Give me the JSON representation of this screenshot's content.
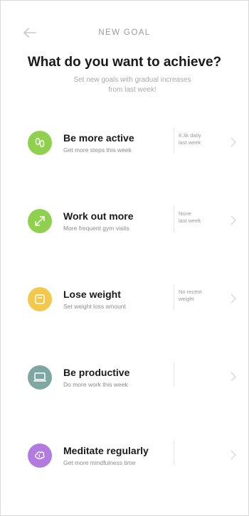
{
  "header": {
    "title": "NEW GOAL",
    "back_icon": "arrow-left-icon"
  },
  "headline": "What do you want to achieve?",
  "subtitle": "Set new goals with gradual increases from last week!",
  "goals": [
    {
      "title": "Be more active",
      "subtitle": "Get more steps this week",
      "stat": "8.3k daily\nlast week",
      "icon": "footprints-icon",
      "color": "#8fd14f"
    },
    {
      "title": "Work out more",
      "subtitle": "More frequent gym visits",
      "stat": "None\nlast week",
      "icon": "expand-arrows-icon",
      "color": "#8fd14f"
    },
    {
      "title": "Lose weight",
      "subtitle": "Set weight loss amount",
      "stat": "No recent\nweight",
      "icon": "scale-icon",
      "color": "#f2c94c"
    },
    {
      "title": "Be productive",
      "subtitle": "Do more work this week",
      "stat": "",
      "icon": "laptop-icon",
      "color": "#7fa7a2"
    },
    {
      "title": "Meditate regularly",
      "subtitle": "Get more mindfulness time",
      "stat": "",
      "icon": "brain-icon",
      "color": "#b17be0"
    }
  ]
}
